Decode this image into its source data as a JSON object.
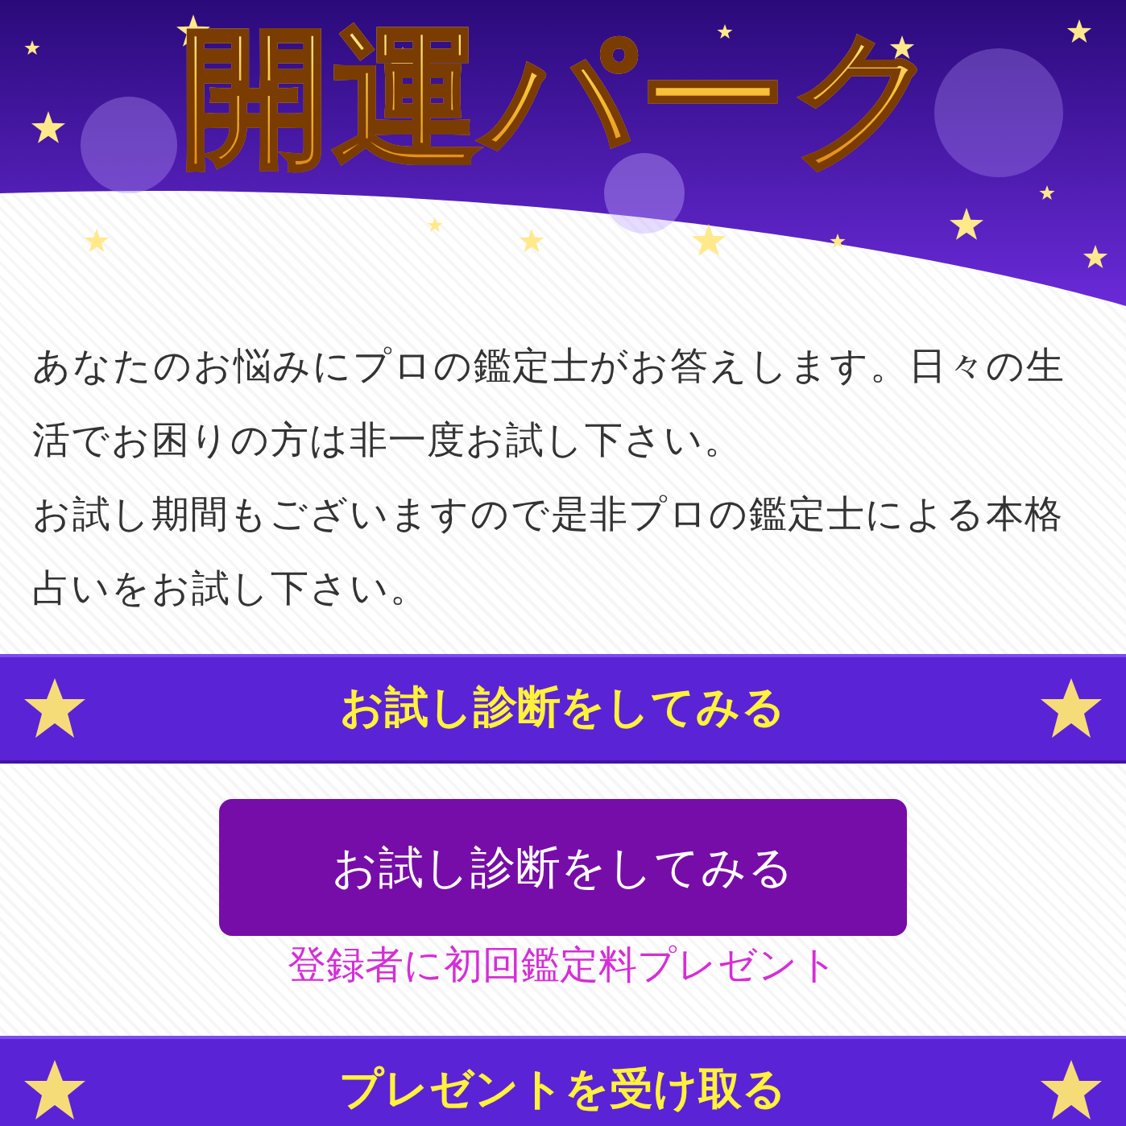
{
  "header": {
    "logo": "開運パーク"
  },
  "intro": [
    "あなたのお悩みにプロの鑑定士がお答えします。日々の生活でお困りの方は非一度お試し下さい。",
    "お試し期間もございますので是非プロの鑑定士による本格占いをお試し下さい。"
  ],
  "trial_band": {
    "label": "お試し診断をしてみる"
  },
  "trial_button": {
    "label": "お試し診断をしてみる"
  },
  "note": "登録者に初回鑑定料プレゼント",
  "present_band": {
    "label": "プレゼントを受け取る"
  }
}
